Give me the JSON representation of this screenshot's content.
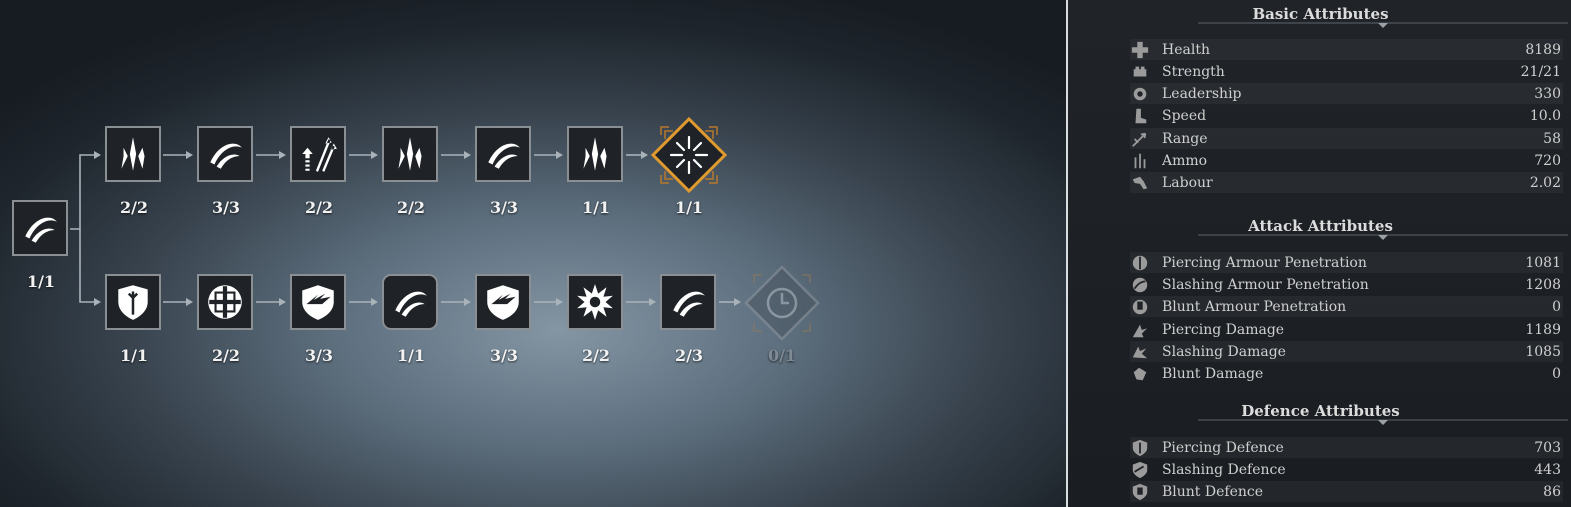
{
  "tree": {
    "root": {
      "icon": "crescent-slash-icon",
      "label": "1/1"
    },
    "top_row": [
      {
        "icon": "spear-tip-icon",
        "label": "2/2"
      },
      {
        "icon": "crescent-slash-icon",
        "label": "3/3"
      },
      {
        "icon": "arrows-up-icon",
        "label": "2/2"
      },
      {
        "icon": "spear-tip-icon",
        "label": "2/2"
      },
      {
        "icon": "crescent-slash-icon",
        "label": "3/3"
      },
      {
        "icon": "spear-tip-icon",
        "label": "1/1"
      },
      {
        "icon": "burst-diamond-icon",
        "label": "1/1"
      }
    ],
    "bottom_row": [
      {
        "icon": "shield-arrows-icon",
        "label": "1/1"
      },
      {
        "icon": "cross-shield-icon",
        "label": "2/2"
      },
      {
        "icon": "wing-shield-icon",
        "label": "3/3"
      },
      {
        "icon": "crescent-slash-icon",
        "label": "1/1"
      },
      {
        "icon": "wing-shield-icon",
        "label": "3/3"
      },
      {
        "icon": "impact-burst-icon",
        "label": "2/2"
      },
      {
        "icon": "crescent-slash-icon",
        "label": "2/3"
      },
      {
        "icon": "locked-clock-diamond-icon",
        "label": "0/1"
      }
    ],
    "colors": {
      "accent": "#e09a2e",
      "node_bg": "#1f2327",
      "node_border": "#8a8f94",
      "locked": "#7f8a94"
    }
  },
  "panel": {
    "sections": [
      {
        "title": "Basic Attributes",
        "rows": [
          {
            "icon": "health-cross-icon",
            "name": "Health",
            "value": "8189"
          },
          {
            "icon": "strength-fist-icon",
            "name": "Strength",
            "value": "21/21"
          },
          {
            "icon": "leadership-gear-icon",
            "name": "Leadership",
            "value": "330"
          },
          {
            "icon": "speed-boot-icon",
            "name": "Speed",
            "value": "10.0"
          },
          {
            "icon": "range-arrow-icon",
            "name": "Range",
            "value": "58"
          },
          {
            "icon": "ammo-bars-icon",
            "name": "Ammo",
            "value": "720"
          },
          {
            "icon": "labour-tool-icon",
            "name": "Labour",
            "value": "2.02"
          }
        ]
      },
      {
        "title": "Attack Attributes",
        "rows": [
          {
            "icon": "piercing-penetration-icon",
            "name": "Piercing Armour Penetration",
            "value": "1081"
          },
          {
            "icon": "slashing-penetration-icon",
            "name": "Slashing Armour Penetration",
            "value": "1208"
          },
          {
            "icon": "blunt-penetration-icon",
            "name": "Blunt Armour Penetration",
            "value": "0"
          },
          {
            "icon": "piercing-damage-icon",
            "name": "Piercing Damage",
            "value": "1189"
          },
          {
            "icon": "slashing-damage-icon",
            "name": "Slashing Damage",
            "value": "1085"
          },
          {
            "icon": "blunt-damage-icon",
            "name": "Blunt Damage",
            "value": "0"
          }
        ]
      },
      {
        "title": "Defence Attributes",
        "rows": [
          {
            "icon": "piercing-defence-icon",
            "name": "Piercing Defence",
            "value": "703"
          },
          {
            "icon": "slashing-defence-icon",
            "name": "Slashing Defence",
            "value": "443"
          },
          {
            "icon": "blunt-defence-icon",
            "name": "Blunt Defence",
            "value": "86"
          }
        ]
      }
    ]
  }
}
